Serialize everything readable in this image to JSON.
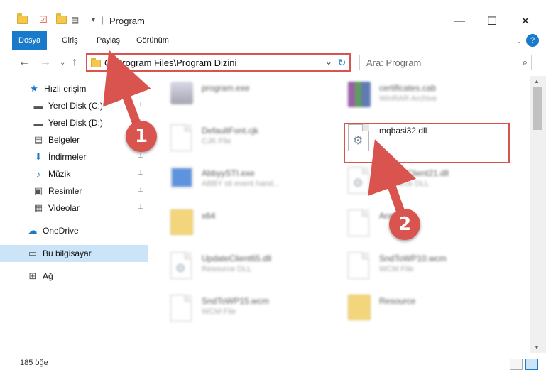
{
  "window": {
    "title": "Program",
    "minimize_glyph": "—",
    "maximize_glyph": "☐",
    "close_glyph": "✕"
  },
  "ribbon": {
    "tabs": [
      {
        "label": "Dosya",
        "active": true
      },
      {
        "label": "Giriş",
        "active": false
      },
      {
        "label": "Paylaş",
        "active": false
      },
      {
        "label": "Görünüm",
        "active": false
      }
    ],
    "help": "?"
  },
  "address": {
    "path": "C:\\Program Files\\Program Dizini",
    "refresh_glyph": "↻",
    "dropdown_glyph": "⌄"
  },
  "search": {
    "placeholder": "Ara: Program"
  },
  "sidebar": {
    "items": [
      {
        "label": "Hızlı erişim",
        "icon": "star-icon",
        "glyph": "★",
        "pinned": false
      },
      {
        "label": "Yerel Disk (C:)",
        "icon": "drive-icon",
        "glyph": "▬",
        "pinned": true
      },
      {
        "label": "Yerel Disk (D:)",
        "icon": "drive-icon",
        "glyph": "▬",
        "pinned": true
      },
      {
        "label": "Belgeler",
        "icon": "documents-icon",
        "glyph": "▤",
        "pinned": true
      },
      {
        "label": "İndirmeler",
        "icon": "download-icon",
        "glyph": "⬇",
        "pinned": true
      },
      {
        "label": "Müzik",
        "icon": "music-icon",
        "glyph": "♪",
        "pinned": true
      },
      {
        "label": "Resimler",
        "icon": "pictures-icon",
        "glyph": "▣",
        "pinned": true
      },
      {
        "label": "Videolar",
        "icon": "video-icon",
        "glyph": "▦",
        "pinned": true
      },
      {
        "label": "OneDrive",
        "icon": "cloud-icon",
        "glyph": "☁",
        "pinned": false
      },
      {
        "label": "Bu bilgisayar",
        "icon": "computer-icon",
        "glyph": "▭",
        "pinned": false,
        "selected": true
      },
      {
        "label": "Ağ",
        "icon": "network-icon",
        "glyph": "⊞",
        "pinned": false
      }
    ]
  },
  "files": [
    {
      "name": "program.exe",
      "sub": "",
      "type": "exe"
    },
    {
      "name": "certificates.cab",
      "sub": "WinRAR Archive",
      "type": "rar"
    },
    {
      "name": "DefaultFont.cjk",
      "sub": "CJK File",
      "type": "doc"
    },
    {
      "name": "mqbasi32.dll",
      "sub": "",
      "type": "dll"
    },
    {
      "name": "AbbyySTI.exe",
      "sub": "ABBY sti event hand...",
      "type": "blueapp"
    },
    {
      "name": "UpdateClient21.dll",
      "sub": "Resource DLL",
      "type": "dll"
    },
    {
      "name": "x64",
      "sub": "",
      "type": "folder"
    },
    {
      "name": "Arabic.cd",
      "sub": "",
      "type": "doc"
    },
    {
      "name": "UpdateClient65.dll",
      "sub": "Resource DLL",
      "type": "dll"
    },
    {
      "name": "SndToWP10.wcm",
      "sub": "WCM File",
      "type": "doc"
    },
    {
      "name": "SndToWP15.wcm",
      "sub": "WCM File",
      "type": "doc"
    },
    {
      "name": "Resource",
      "sub": "",
      "type": "folder"
    }
  ],
  "status": {
    "count": "185 öğe"
  },
  "annotations": {
    "marker1": "1",
    "marker2": "2"
  },
  "colors": {
    "accent": "#1979ca",
    "highlight": "#d9534f"
  }
}
